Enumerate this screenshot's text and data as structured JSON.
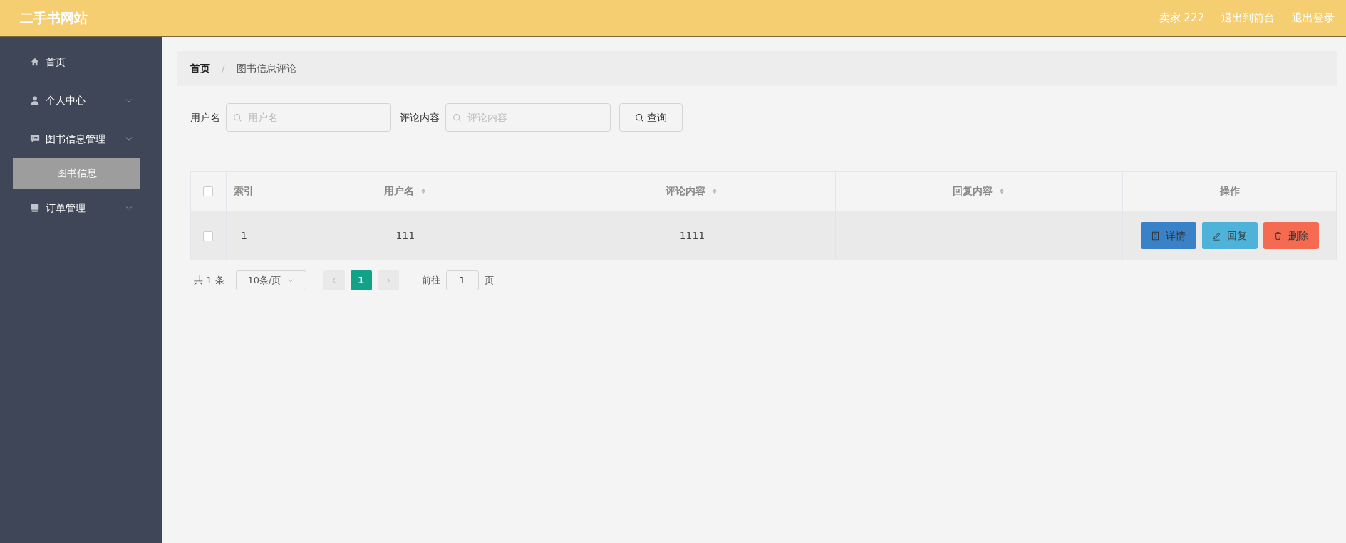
{
  "header": {
    "title": "二手书网站",
    "user": "卖家 222",
    "links": [
      "退出到前台",
      "退出登录"
    ]
  },
  "sidebar": {
    "items": [
      {
        "label": "首页",
        "kind": "item",
        "selected": false
      },
      {
        "label": "个人中心",
        "kind": "submenu",
        "selected": false
      },
      {
        "label": "图书信息管理",
        "kind": "submenu",
        "selected": false,
        "children": [
          {
            "label": "图书信息",
            "selected": true
          }
        ]
      },
      {
        "label": "订单管理",
        "kind": "submenu",
        "selected": false
      }
    ]
  },
  "breadcrumb": {
    "items": [
      "首页",
      "图书信息评论"
    ],
    "separator": "/"
  },
  "search": {
    "fields": [
      {
        "label": "用户名",
        "placeholder": "用户名"
      },
      {
        "label": "评论内容",
        "placeholder": "评论内容"
      }
    ],
    "button": "查询"
  },
  "table": {
    "select_all": {
      "checked": false
    },
    "columns": [
      {
        "label": "索引",
        "sortable": false
      },
      {
        "label": "用户名",
        "sortable": true
      },
      {
        "label": "评论内容",
        "sortable": true
      },
      {
        "label": "回复内容",
        "sortable": true
      },
      {
        "label": "操作",
        "sortable": false
      }
    ],
    "rows": [
      {
        "checked": false,
        "index": "1",
        "username": "111",
        "comment": "1111",
        "actions": [
          {
            "kind": "detail",
            "label": "详情"
          },
          {
            "kind": "reply",
            "label": "回复"
          },
          {
            "kind": "delete",
            "label": "删除"
          }
        ]
      }
    ]
  },
  "pagination": {
    "total": "共 1 条",
    "page_size": "10条/页",
    "pages": [
      {
        "label": "1",
        "selected": true
      }
    ],
    "goto_label": "前往",
    "goto_value": "1",
    "goto_suffix": "页"
  }
}
